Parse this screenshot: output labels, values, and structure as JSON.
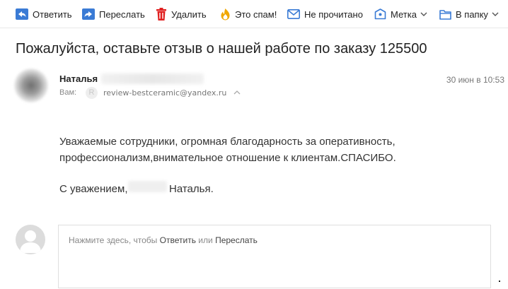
{
  "toolbar": {
    "reply": "Ответить",
    "forward": "Переслать",
    "delete": "Удалить",
    "spam": "Это спам!",
    "unread": "Не прочитано",
    "label": "Метка",
    "folder": "В папку"
  },
  "colors": {
    "accent": "#3a7bd5",
    "delete": "#e02020",
    "spam": "#f0a800"
  },
  "message": {
    "subject": "Пожалуйста, оставьте отзыв о нашей работе по заказу 125500",
    "sender_name": "Наталья",
    "date": "30 июн в 10:53",
    "to_label": "Вам:",
    "to_avatar_letter": "R",
    "to_email": "review-bestceramic@yandex.ru",
    "body_line1": "Уважаемые сотрудники, огромная благодарность за оперативность,",
    "body_line2": "профессионализм,внимательное отношение к клиентам.СПАСИБО.",
    "sign_prefix": "С уважением,",
    "sign_name": "Наталья."
  },
  "reply": {
    "hint_prefix": "Нажмите здесь, чтобы",
    "reply_link": "Ответить",
    "or": "или",
    "forward_link": "Переслать"
  }
}
